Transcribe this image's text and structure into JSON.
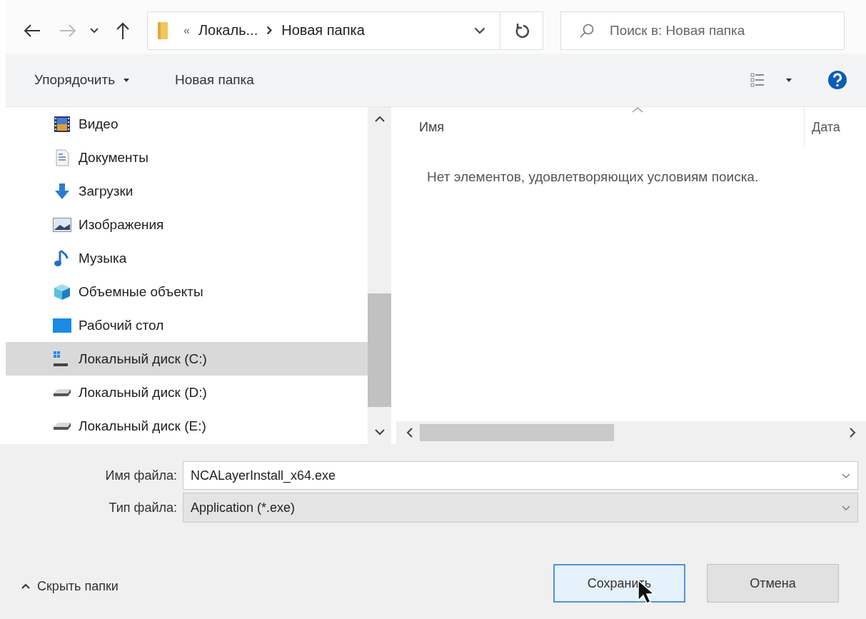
{
  "nav": {
    "address": {
      "overflow": "«",
      "segments": [
        "Локаль...",
        "Новая папка"
      ]
    },
    "search": {
      "placeholder": "Поиск в: Новая папка"
    }
  },
  "toolbar": {
    "organize": "Упорядочить",
    "new_folder": "Новая папка"
  },
  "sidebar": {
    "items": [
      {
        "label": "Видео",
        "kind": "video",
        "selected": false
      },
      {
        "label": "Документы",
        "kind": "documents",
        "selected": false
      },
      {
        "label": "Загрузки",
        "kind": "downloads",
        "selected": false
      },
      {
        "label": "Изображения",
        "kind": "pictures",
        "selected": false
      },
      {
        "label": "Музыка",
        "kind": "music",
        "selected": false
      },
      {
        "label": "Объемные объекты",
        "kind": "objects",
        "selected": false
      },
      {
        "label": "Рабочий стол",
        "kind": "desktop",
        "selected": false
      },
      {
        "label": "Локальный диск (C:)",
        "kind": "system_drive",
        "selected": true
      },
      {
        "label": "Локальный диск (D:)",
        "kind": "drive",
        "selected": false
      },
      {
        "label": "Локальный диск (E:)",
        "kind": "drive",
        "selected": false
      }
    ]
  },
  "file_list": {
    "columns": [
      {
        "label": "Имя",
        "sorted": true
      },
      {
        "label": "Дата",
        "sorted": false
      }
    ],
    "empty_message": "Нет элементов, удовлетворяющих условиям поиска."
  },
  "form": {
    "fields": [
      {
        "label": "Имя файла:",
        "value": "NCALayerInstall_x64.exe",
        "kind": "editable"
      },
      {
        "label": "Тип файла:",
        "value": "Application (*.exe)",
        "kind": "select"
      }
    ]
  },
  "hide_folders": "Скрыть папки",
  "buttons": [
    {
      "label": "Сохранить",
      "kind": "primary"
    },
    {
      "label": "Отмена",
      "kind": "secondary"
    }
  ]
}
